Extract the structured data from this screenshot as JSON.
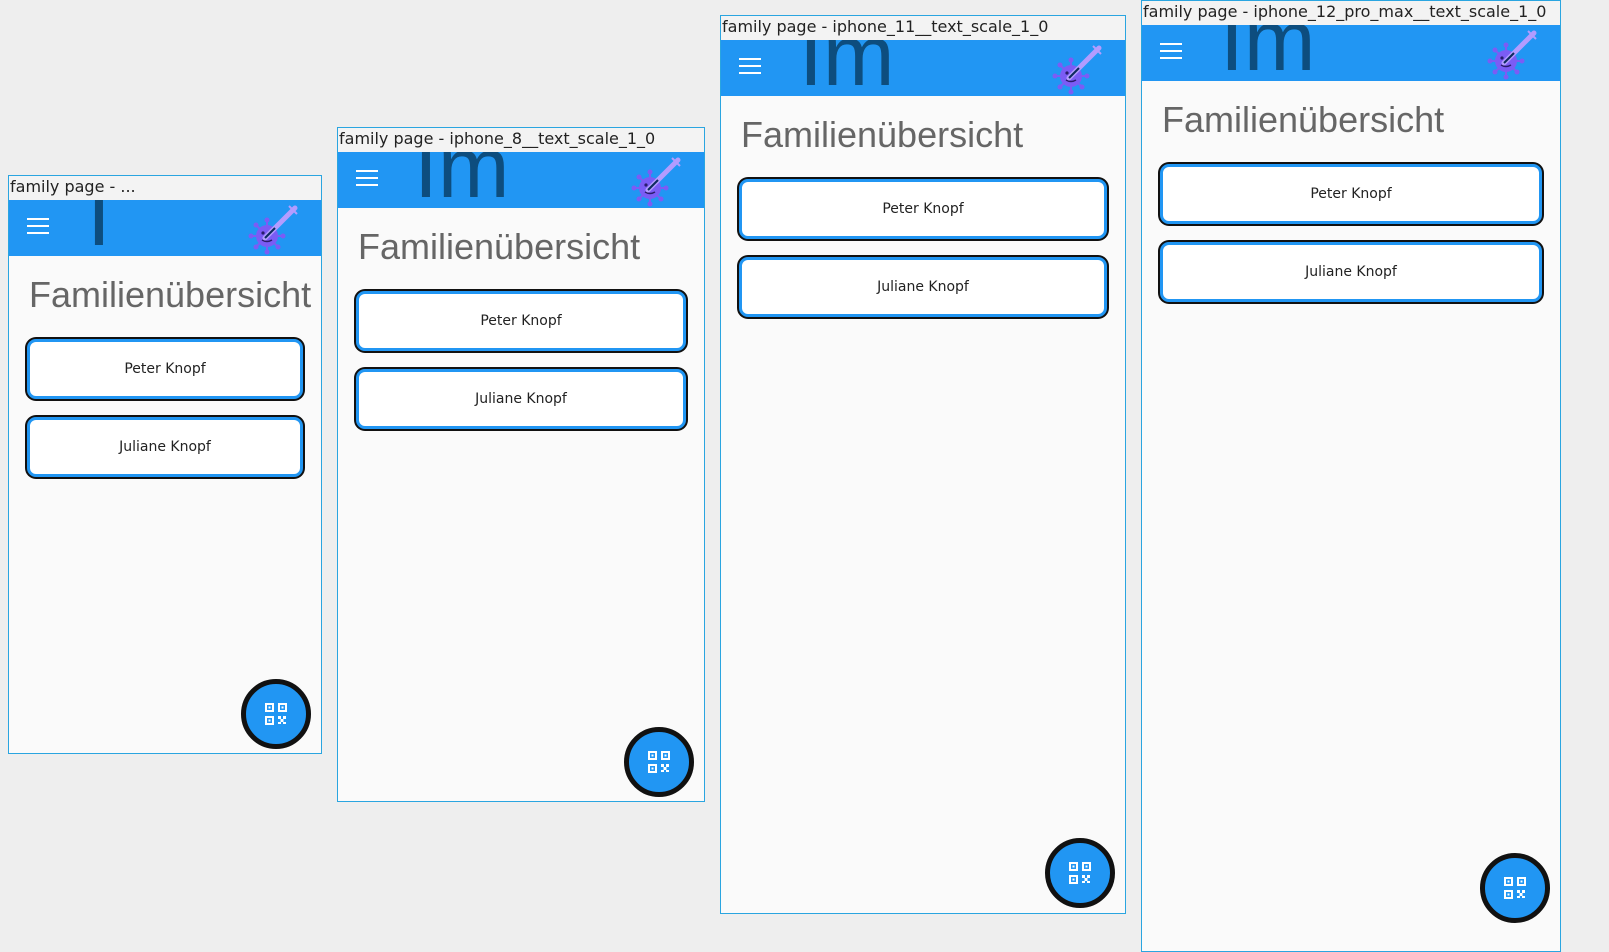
{
  "frames": [
    {
      "caption": "family page - ...",
      "logo_text": "I",
      "page_title": "Familienübersicht",
      "members": [
        "Peter Knopf",
        "Juliane Knopf"
      ]
    },
    {
      "caption": "family page - iphone_8__text_scale_1_0",
      "logo_text": "Im",
      "page_title": "Familienübersicht",
      "members": [
        "Peter Knopf",
        "Juliane Knopf"
      ]
    },
    {
      "caption": "family page - iphone_11__text_scale_1_0",
      "logo_text": "Im",
      "page_title": "Familienübersicht",
      "members": [
        "Peter Knopf",
        "Juliane Knopf"
      ]
    },
    {
      "caption": "family page - iphone_12_pro_max__text_scale_1_0",
      "logo_text": "Im",
      "page_title": "Familienübersicht",
      "members": [
        "Peter Knopf",
        "Juliane Knopf"
      ]
    }
  ],
  "icons": {
    "menu": "menu-icon",
    "logo": "virus-syringe-icon",
    "fab": "qr-code-scan-icon"
  },
  "colors": {
    "app_bar": "#2196f3",
    "logo_text": "#0d4d7e",
    "frame_border": "#2aa5e0",
    "page_background": "#fafafa",
    "title_text": "#666666",
    "button_border": "#2196f3",
    "fab": "#2196f3"
  }
}
